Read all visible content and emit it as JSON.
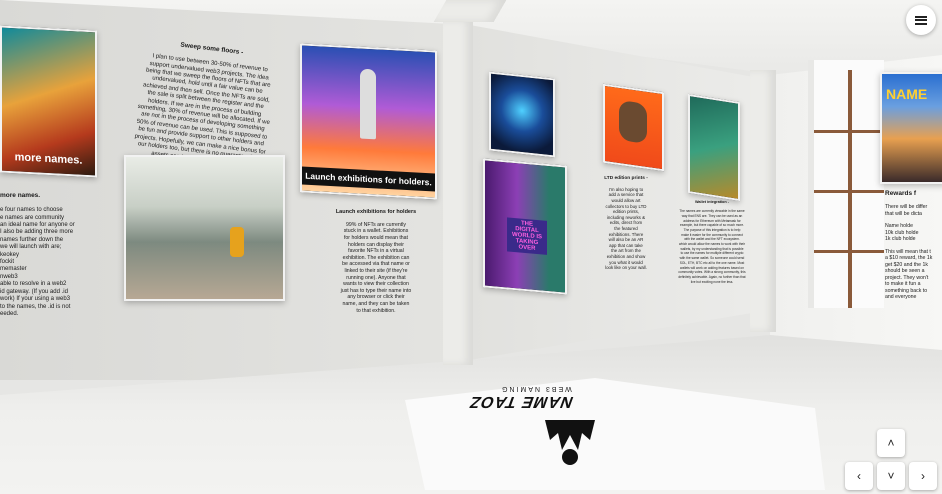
{
  "menu": {
    "label": "menu"
  },
  "nav": {
    "up": "˄",
    "down": "˅",
    "left": "‹",
    "right": "›"
  },
  "left_wall": {
    "panel1_caption": "more names.",
    "section_heading": "more names.",
    "section_text": "e four names to choose\ne names are community\nan ideal name for anyone or\nI also be adding three more\nnames further down the\nwe will launch with are;\nkeokey\nfockit\nmemaster\nnweb3\nable to resolve in a web2\nid gateway. (If you add .id\nwork) If your using a web3\nto the names, the .id is not\needed.",
    "sweep_heading": "Sweep some floors -",
    "sweep_text": "I plan to use between 30-50% of revenue to\nsupport undervalued web3 projects. The idea\nbeing that we sweep the floors of NFTs that are\nundervalued, hold until a fair value can be\nachieved and then sell. Once the NFTs are sold,\nthe sale is split between the register and the\nholders. If we are in the process of building\nsomething, 30% of revenue will be allocated. If we\nare not in the process of developing something\n50% of revenue can be used. This is supposed to\nbe fun and provide support to other holders and\nprojects. Hopefully, we can make a nice bonus for\nour holders too, but there is no guarantee. The\nassets can just as easily go to zero.",
    "rocket_caption": "Launch exhibitions for holders.",
    "launch_heading": "Launch exhibitions for holders",
    "launch_text": "99% of NFTs are currently\nstuck in a wallet. Exhibitions\nfor holders would mean that\nholders can display their\nfavorite NFTs in a virtual\nexhibition. The exhibition can\nbe accessed via that name or\nlinked to their site (if they're\nrunning one). Anyone that\nwants to view their collection\njust has to type their name into\nany browser or click their\nname, and they can be taken\nto that exhibition."
  },
  "mid_wall": {
    "digital_caption": "THE DIGITAL WORLD IS TAKING OVER",
    "ltd_heading": "LTD edition prints -",
    "ltd_text": "I'm also hoping to\nadd a service that\nwould allow art\ncollectors to buy LTD\nedition prints,\nincluding reworks &\nedits, direct from\nthe featured\nexhibitions. There\nwill also be an AR\napp that can take\nthe art from the\nexhibition and show\nyou what it would\nlook like on your wall.",
    "wallet_heading": "Wallet integration -",
    "wallet_text": "The names are currently viewable in the same\nway that ENS are. They can be used as an\naddress for Ethereum with Metamask for\nexample, but there capable of so much more.\nThe purpose of this integration is to help\nmake it easier for the community to connect\nwith the wallet and the NFT ecosystem.\nwhich would allow the names to work with their\nwallets, by my understanding that is possible\nto use the names for multiple different crypto\nwith the same wallet. So someone could send\nSOL, ETH, BTC etc all to the one name. Most\nwallets will work on adding features based on\ncommunity votes. With a strong community, this\ndefinitely achievable. Again, no further than that\nlive but exciting none the less."
  },
  "right_wall": {
    "banner_text": "NAME",
    "rewards_heading": "Rewards f",
    "rewards_text": "There will be differ\nthat will be dicta\n\nName holde\n10k club holde\n1k club holde\n\nThis will mean that t\na $10 reward, the 1k\nget $20 and the 1k\nshould be seen a\nproject. They won't\nto make it fun a\nsomething back to\nand everyone"
  },
  "rug": {
    "title": "NAME TAOZ",
    "subtitle": "WEB3 NAMING"
  },
  "colors": {
    "wall": "#e4e4e1",
    "floor": "#efefed",
    "frame": "#111111",
    "window_wood": "#8a5a3a"
  }
}
